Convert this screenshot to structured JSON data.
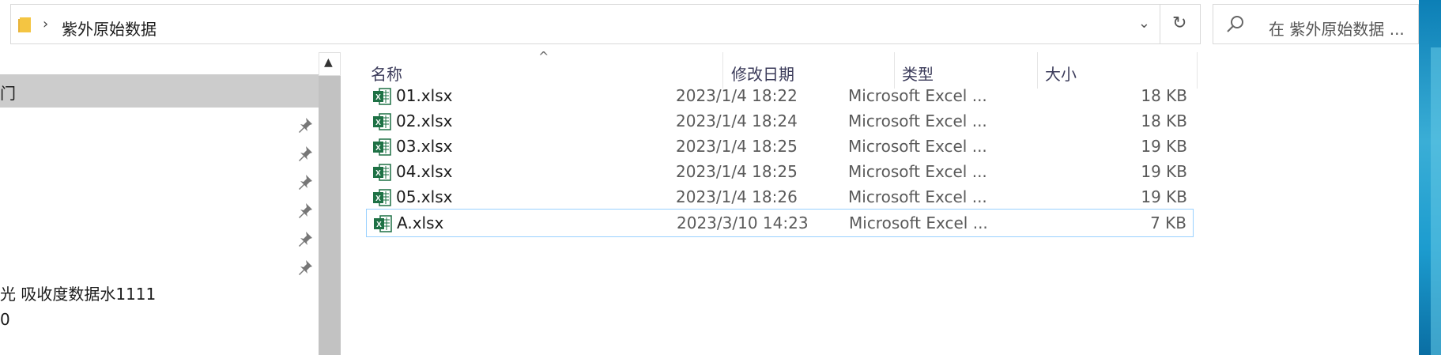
{
  "address_bar": {
    "breadcrumb_separator": "›",
    "current_folder": "紫外原始数据",
    "dropdown_glyph": "⌄"
  },
  "refresh": {
    "glyph": "↻"
  },
  "search": {
    "placeholder": "在 紫外原始数据 ..."
  },
  "nav_pane": {
    "selected_item_label": "门",
    "items": [
      {
        "label": "光 吸收度数据水1111",
        "pinned": true
      },
      {
        "label": "0",
        "pinned": false
      }
    ],
    "pinned_count": 6
  },
  "file_list": {
    "columns": [
      {
        "key": "name",
        "label": "名称"
      },
      {
        "key": "date",
        "label": "修改日期"
      },
      {
        "key": "type",
        "label": "类型"
      },
      {
        "key": "size",
        "label": "大小"
      }
    ],
    "rows": [
      {
        "name": "01.xlsx",
        "date": "2023/1/4 18:22",
        "type": "Microsoft Excel ...",
        "size": "18 KB",
        "selected": false
      },
      {
        "name": "02.xlsx",
        "date": "2023/1/4 18:24",
        "type": "Microsoft Excel ...",
        "size": "18 KB",
        "selected": false
      },
      {
        "name": "03.xlsx",
        "date": "2023/1/4 18:25",
        "type": "Microsoft Excel ...",
        "size": "19 KB",
        "selected": false
      },
      {
        "name": "04.xlsx",
        "date": "2023/1/4 18:25",
        "type": "Microsoft Excel ...",
        "size": "19 KB",
        "selected": false
      },
      {
        "name": "05.xlsx",
        "date": "2023/1/4 18:26",
        "type": "Microsoft Excel ...",
        "size": "19 KB",
        "selected": false
      },
      {
        "name": "A.xlsx",
        "date": "2023/3/10 14:23",
        "type": "Microsoft Excel ...",
        "size": "7 KB",
        "selected": true
      }
    ]
  },
  "icons": {
    "folder": "folder-icon",
    "search": "search-icon",
    "pin": "pin-icon",
    "excel_file": "excel-file-icon"
  },
  "colors": {
    "selection_border": "#99d1ff",
    "nav_selected_bg": "#cccccc",
    "excel_green": "#1e7145",
    "folder_yellow": "#f4c542"
  }
}
